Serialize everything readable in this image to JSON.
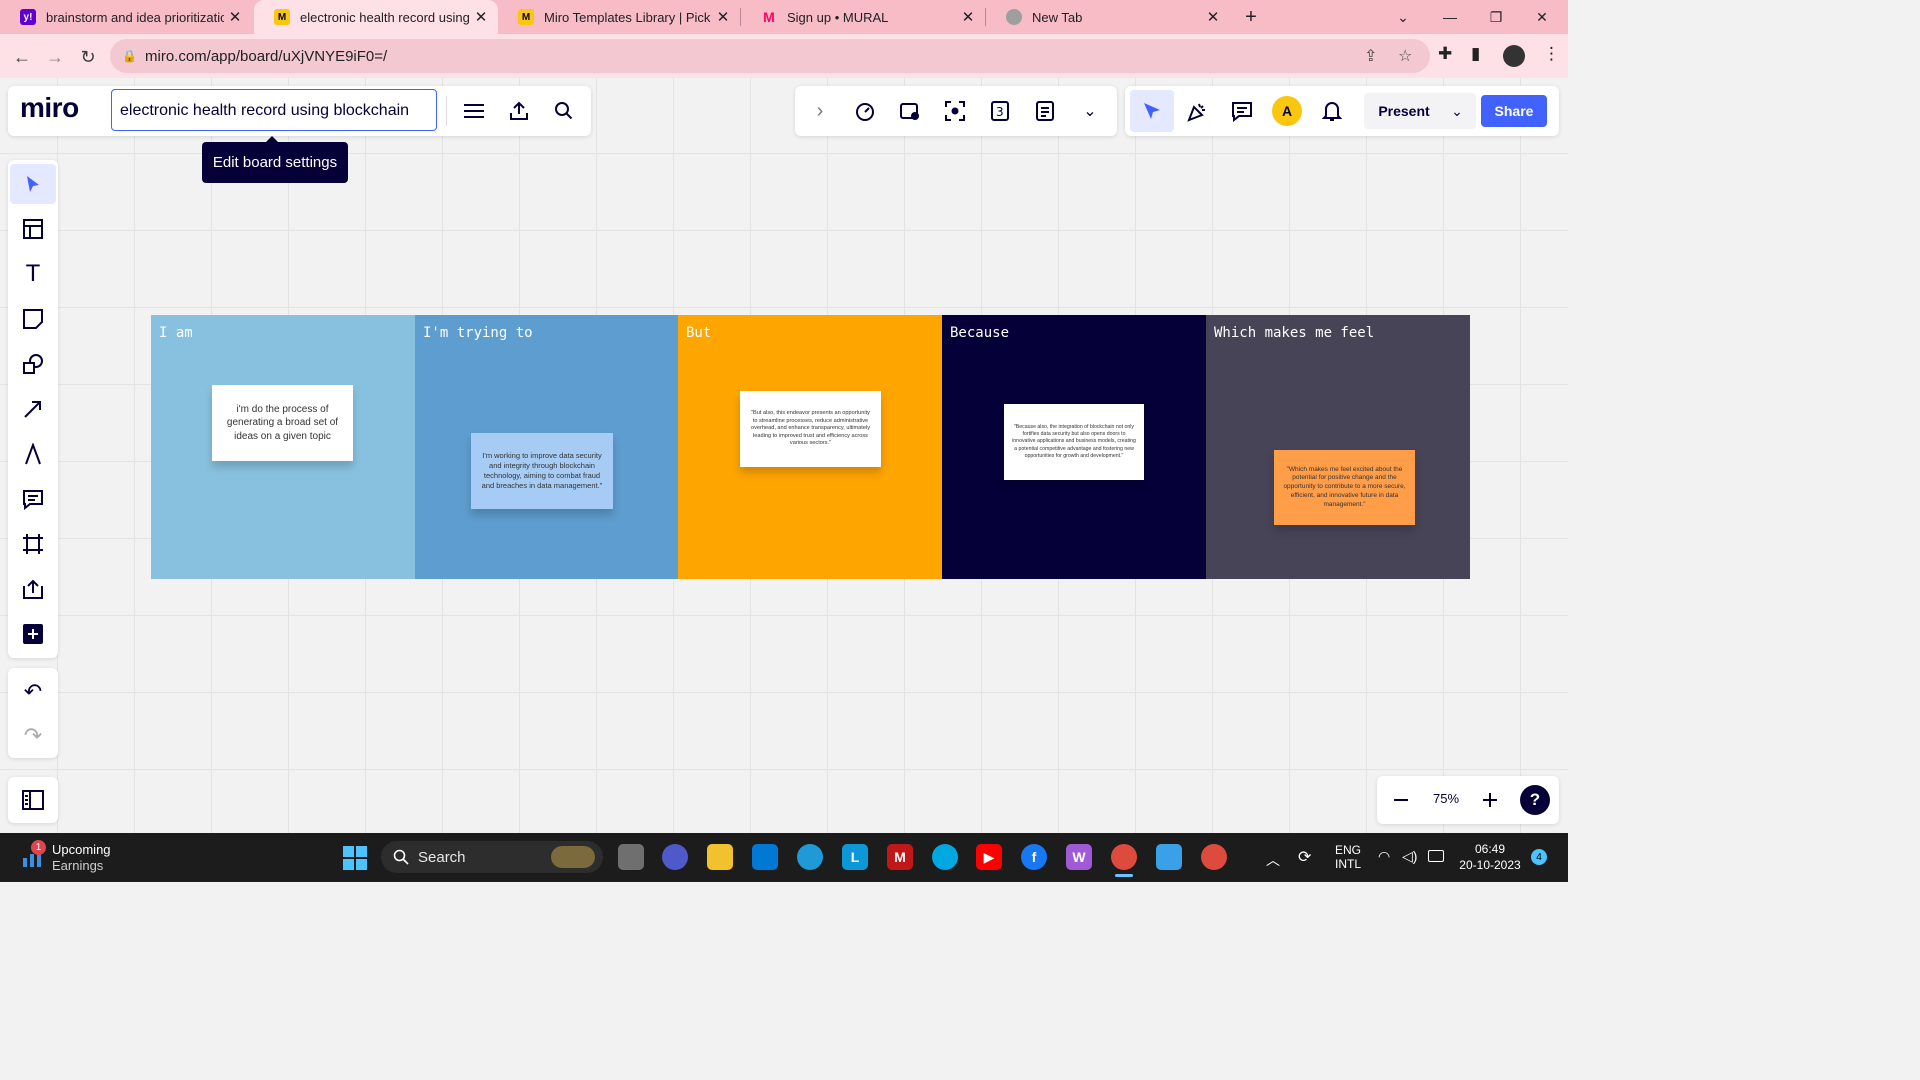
{
  "browser": {
    "tabs": [
      {
        "title": "brainstorm and idea prioritization",
        "favicon": "y!",
        "favicon_color": "#6001d2",
        "active": false
      },
      {
        "title": "electronic health record using blockchain",
        "favicon": "M",
        "favicon_color": "#fac710",
        "active": true
      },
      {
        "title": "Miro Templates Library | Pick from",
        "favicon": "M",
        "favicon_color": "#fac710",
        "active": false
      },
      {
        "title": "Sign up • MURAL",
        "favicon": "M",
        "favicon_color": "#ff0066",
        "active": false
      },
      {
        "title": "New Tab",
        "favicon": "chrome-icon",
        "favicon_color": "#9e9e9e",
        "active": false
      }
    ],
    "url": "miro.com/app/board/uXjVNYE9iF0=/"
  },
  "miro": {
    "logo": "miro",
    "board_name": "electronic health record using blockchain",
    "tooltip": "Edit board settings",
    "present_label": "Present",
    "share_label": "Share",
    "avatar_initial": "A",
    "zoom": "75%",
    "help_label": "?"
  },
  "columns": [
    {
      "title": "I am",
      "color": "#88c1e0",
      "sticky": {
        "text": "i'm do the process of generating a broad set of ideas on a given topic",
        "color": "#ffffff"
      }
    },
    {
      "title": "I'm trying to",
      "color": "#5e9dcf",
      "sticky": {
        "text": "I'm working to improve data security and integrity through blockchain technology, aiming to combat fraud and breaches in data management.\"",
        "color": "#a6ccf5"
      }
    },
    {
      "title": "But",
      "color": "#ffa500",
      "sticky": {
        "text": "\"But also, this endeavor presents an opportunity to streamline processes, reduce administrative overhead, and enhance transparency, ultimately leading to improved trust and efficiency across various sectors.\"",
        "color": "#ffffff"
      }
    },
    {
      "title": "Because",
      "color": "#050038",
      "sticky": {
        "text": "\"Because also, the integration of blockchain not only fortifies data security but also opens doors to innovative applications and business models, creating a potential competitive advantage and fostering new opportunities for growth and development.\"",
        "color": "#ffffff"
      }
    },
    {
      "title": "Which makes me feel",
      "color": "#474458",
      "sticky": {
        "text": "\"Which makes me feel excited about the potential for positive change and the opportunity to contribute to a more secure, efficient, and innovative future in data management.\"",
        "color": "#ff9d48"
      }
    }
  ],
  "taskbar": {
    "widget_title": "Upcoming",
    "widget_subtitle": "Earnings",
    "widget_badge": "1",
    "search_label": "Search",
    "lang_line1": "ENG",
    "lang_line2": "INTL",
    "time": "06:49",
    "date": "20-10-2023",
    "notification_count": "4"
  }
}
